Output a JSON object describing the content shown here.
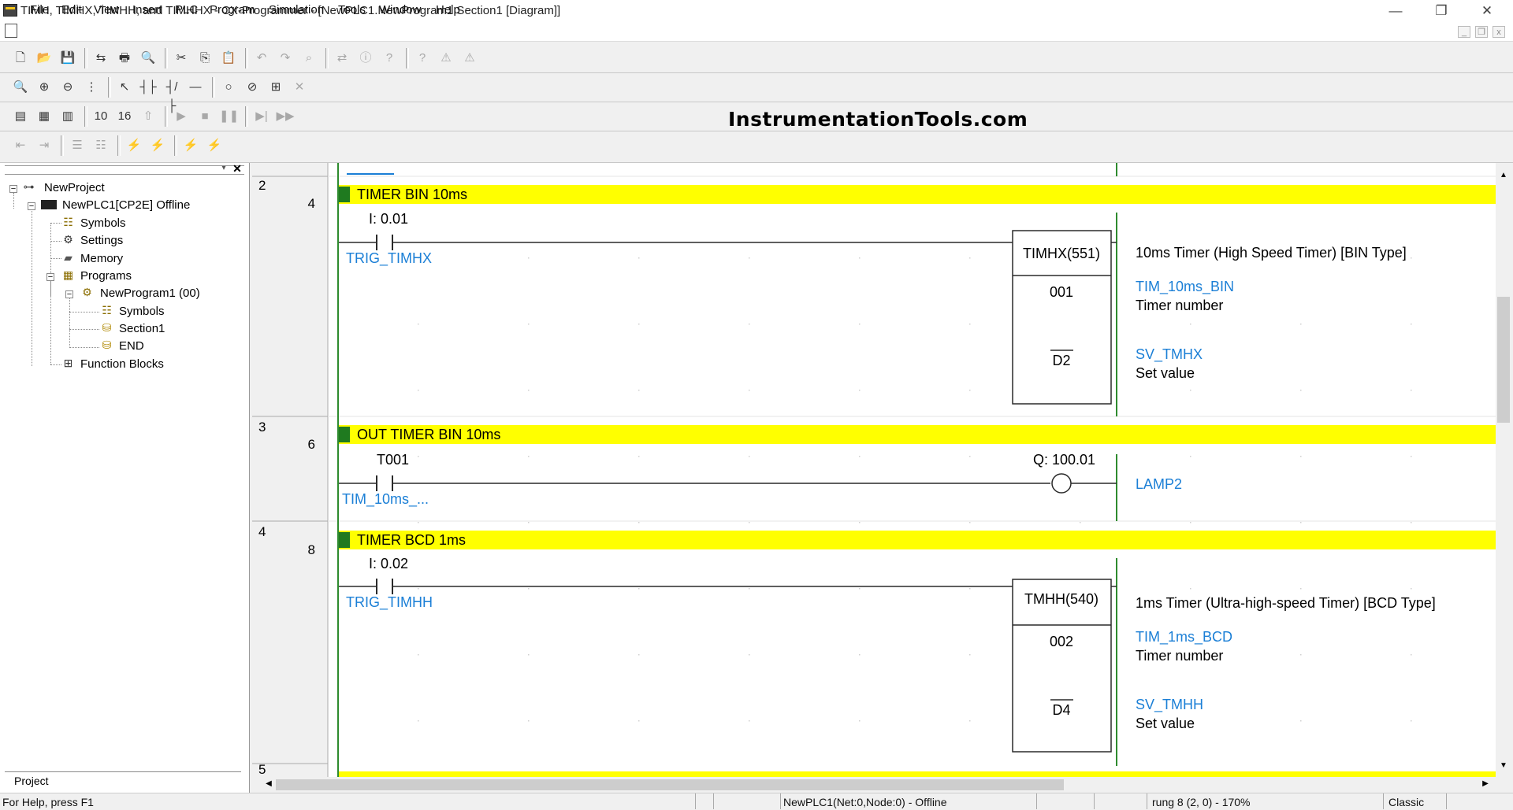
{
  "window": {
    "title": "TIMH, TIMHX, TIMHH, and TIMHHX - CX-Programmer - [NewPLC1.NewProgram1.Section1 [Diagram]]",
    "minimize_glyph": "—",
    "restore_glyph": "❐",
    "close_glyph": "✕"
  },
  "menu": [
    "File",
    "Edit",
    "View",
    "Insert",
    "PLC",
    "Program",
    "Simulation",
    "Tools",
    "Window",
    "Help"
  ],
  "mdi_controls": [
    "_",
    "❐",
    "x"
  ],
  "brand_text": "InstrumentationTools.com",
  "toolbars": {
    "row1": [
      {
        "icon": "new-icon",
        "glyph": "🗋"
      },
      {
        "icon": "open-icon",
        "glyph": "📂"
      },
      {
        "icon": "save-icon",
        "glyph": "💾"
      },
      {
        "icon": "compare-icon",
        "glyph": "⇆"
      },
      {
        "icon": "print-icon",
        "glyph": "🖶"
      },
      {
        "icon": "print-preview-icon",
        "glyph": "🔍"
      },
      {
        "icon": "cut-icon",
        "glyph": "✂"
      },
      {
        "icon": "copy-icon",
        "glyph": "⎘"
      },
      {
        "icon": "paste-icon",
        "glyph": "📋"
      },
      {
        "icon": "undo-icon",
        "glyph": "↶"
      },
      {
        "icon": "redo-icon",
        "glyph": "↷"
      },
      {
        "icon": "find-icon",
        "glyph": "⌕"
      },
      {
        "icon": "replace-icon",
        "glyph": "⇄"
      },
      {
        "icon": "info-icon",
        "glyph": "ⓘ"
      },
      {
        "icon": "help-icon",
        "glyph": "?"
      },
      {
        "icon": "context-help-icon",
        "glyph": "?"
      },
      {
        "icon": "warning-icon",
        "glyph": "⚠"
      },
      {
        "icon": "run-icon",
        "glyph": "⚠"
      }
    ],
    "row2": [
      {
        "icon": "zoom-icon",
        "glyph": "🔍"
      },
      {
        "icon": "zoom-in-icon",
        "glyph": "⊕"
      },
      {
        "icon": "zoom-out-icon",
        "glyph": "⊖"
      },
      {
        "icon": "grid-icon",
        "glyph": "⋮"
      },
      {
        "icon": "select-icon",
        "glyph": "↖"
      },
      {
        "icon": "contact-no-icon",
        "glyph": "┤├"
      },
      {
        "icon": "contact-nc-icon",
        "glyph": "┤/├"
      },
      {
        "icon": "line-h-icon",
        "glyph": "—"
      },
      {
        "icon": "coil-icon",
        "glyph": "○"
      },
      {
        "icon": "coil-nc-icon",
        "glyph": "⊘"
      },
      {
        "icon": "instruction-icon",
        "glyph": "⊞"
      },
      {
        "icon": "delete-icon",
        "glyph": "✕"
      }
    ],
    "row3": [
      {
        "icon": "project-window-icon",
        "glyph": "▤"
      },
      {
        "icon": "output-window-icon",
        "glyph": "▦"
      },
      {
        "icon": "watch-window-icon",
        "glyph": "▥"
      },
      {
        "icon": "counter-10-icon",
        "glyph": "10"
      },
      {
        "icon": "counter-16-icon",
        "glyph": "16"
      },
      {
        "icon": "online-icon",
        "glyph": "⇧"
      },
      {
        "icon": "play-icon",
        "glyph": "▶"
      },
      {
        "icon": "stop-icon",
        "glyph": "■"
      },
      {
        "icon": "pause-icon",
        "glyph": "❚❚"
      },
      {
        "icon": "step-icon",
        "glyph": "▶|"
      },
      {
        "icon": "fast-forward-icon",
        "glyph": "▶▶"
      }
    ],
    "row4": [
      {
        "icon": "indent-icon",
        "glyph": "⇤"
      },
      {
        "icon": "outdent-icon",
        "glyph": "⇥"
      },
      {
        "icon": "list-icon",
        "glyph": "☰"
      },
      {
        "icon": "list2-icon",
        "glyph": "☷"
      },
      {
        "icon": "force-on-icon",
        "glyph": "⚡"
      },
      {
        "icon": "force-off-icon",
        "glyph": "⚡"
      },
      {
        "icon": "force-cancel-icon",
        "glyph": "⚡"
      },
      {
        "icon": "force-clear-icon",
        "glyph": "⚡"
      }
    ]
  },
  "project_tree": {
    "project": "NewProject",
    "plc": "NewPLC1[CP2E] Offline",
    "symbols": "Symbols",
    "settings": "Settings",
    "memory": "Memory",
    "programs": "Programs",
    "program": "NewProgram1 (00)",
    "program_symbols": "Symbols",
    "section": "Section1",
    "end": "END",
    "function_blocks": "Function Blocks",
    "tab": "Project"
  },
  "rungs": [
    {
      "rung": "2",
      "step": "4",
      "comment": "TIMER BIN 10ms",
      "contact_address": "I: 0.01",
      "contact_symbol": "TRIG_TIMHX",
      "instr": "TIMHX(551)",
      "op1": "001",
      "op2": "D2",
      "instr_comment": "10ms Timer (High Speed Timer) [BIN Type]",
      "op1_symbol": "TIM_10ms_BIN",
      "op1_desc": "Timer number",
      "op2_symbol": "SV_TMHX",
      "op2_desc": "Set value"
    },
    {
      "rung": "3",
      "step": "6",
      "comment": "OUT TIMER BIN 10ms",
      "contact_address": "T001",
      "contact_symbol": "TIM_10ms_...",
      "coil_address": "Q: 100.01",
      "coil_symbol": "LAMP2"
    },
    {
      "rung": "4",
      "step": "8",
      "comment": "TIMER BCD 1ms",
      "contact_address": "I: 0.02",
      "contact_symbol": "TRIG_TIMHH",
      "instr": "TMHH(540)",
      "op1": "002",
      "op2": "D4",
      "instr_comment": "1ms Timer (Ultra-high-speed Timer) [BCD Type]",
      "op1_symbol": "TIM_1ms_BCD",
      "op1_desc": "Timer number",
      "op2_symbol": "SV_TMHH",
      "op2_desc": "Set value"
    }
  ],
  "next_rung": "5",
  "status_bar": {
    "help": "For Help, press F1",
    "connection": "NewPLC1(Net:0,Node:0) - Offline",
    "position": "rung 8 (2, 0)  - 170%",
    "mode": "Classic"
  },
  "colors": {
    "comment_bar": "#ffff00",
    "comment_marker": "#1f7a1f",
    "symbol_text": "#1b7fd6",
    "rail": "#2e8b2e",
    "rung_line": "#2a2a2a"
  }
}
